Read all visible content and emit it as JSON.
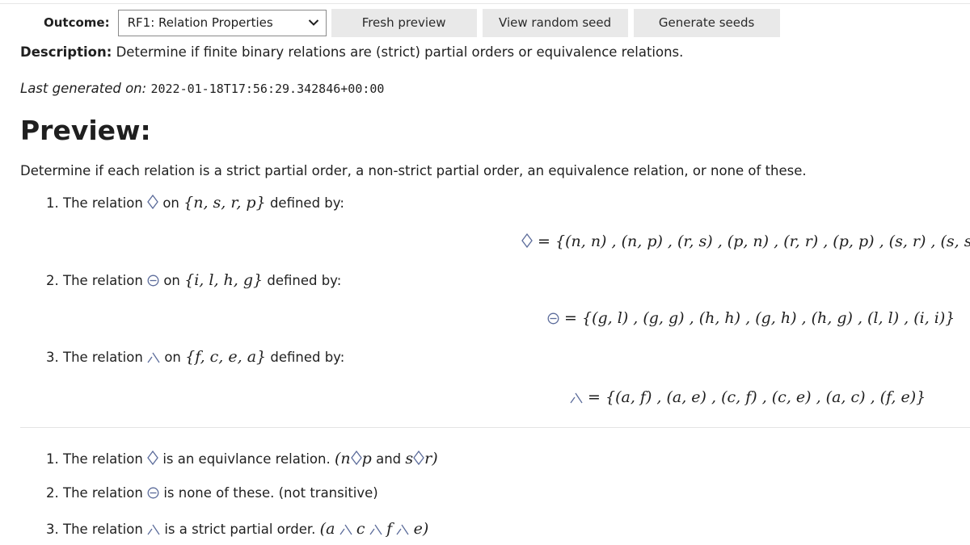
{
  "toolbar": {
    "outcome_label": "Outcome:",
    "outcome_value": "RF1: Relation Properties",
    "buttons": [
      "Fresh preview",
      "View random seed",
      "Generate seeds"
    ]
  },
  "description": {
    "label": "Description:",
    "text": "Determine if finite binary relations are (strict) partial orders or equivalence relations."
  },
  "last_generated": {
    "label": "Last generated on:",
    "value": "2022-01-18T17:56:29.342846+00:00"
  },
  "preview": {
    "heading": "Preview:",
    "intro": "Determine if each relation is a strict partial order, a non-strict partial order, an equivalence relation, or none of these.",
    "questions": [
      {
        "number": "1.",
        "prefix": "The relation",
        "symbol": "diamond",
        "on": "on",
        "set": "{n, s, r, p}",
        "suffix": "defined by:",
        "definition": "= {(n, n) , (n, p) , (r, s) , (p, n) , (r, r) , (p, p) , (s, r) , (s, s)}"
      },
      {
        "number": "2.",
        "prefix": "The relation",
        "symbol": "circle-minus",
        "on": "on",
        "set": "{i, l, h, g}",
        "suffix": "defined by:",
        "definition": "= {(g, l) , (g, g) , (h, h) , (g, h) , (h, g) , (l, l) , (i, i)}"
      },
      {
        "number": "3.",
        "prefix": "The relation",
        "symbol": "lambda-glyph",
        "on": "on",
        "set": "{f, c, e, a}",
        "suffix": "defined by:",
        "definition": "= {(a, f) , (a, e) , (c, f) , (c, e) , (a, c) , (f, e)}"
      }
    ],
    "answers": [
      {
        "number": "1.",
        "prefix": "The relation",
        "text": "is an equivlance relation.",
        "note_open": "(",
        "note_a": "n",
        "note_b": "p",
        "note_mid": "and",
        "note_c": "s",
        "note_d": "r",
        "note_close": ")"
      },
      {
        "number": "2.",
        "prefix": "The relation",
        "text": "is none of these. (not transitive)"
      },
      {
        "number": "3.",
        "prefix": "The relation",
        "text": "is a strict partial order.",
        "chain": [
          "(a",
          "c",
          "f",
          "e)"
        ]
      }
    ]
  },
  "colors": {
    "button_bg": "#e9e9e9",
    "symbol_stroke": "#5b6b9a",
    "text": "#1f1f1f"
  },
  "icons": [
    "chevron-down-icon",
    "diamond-icon",
    "circle-minus-icon",
    "lambda-glyph-icon"
  ]
}
